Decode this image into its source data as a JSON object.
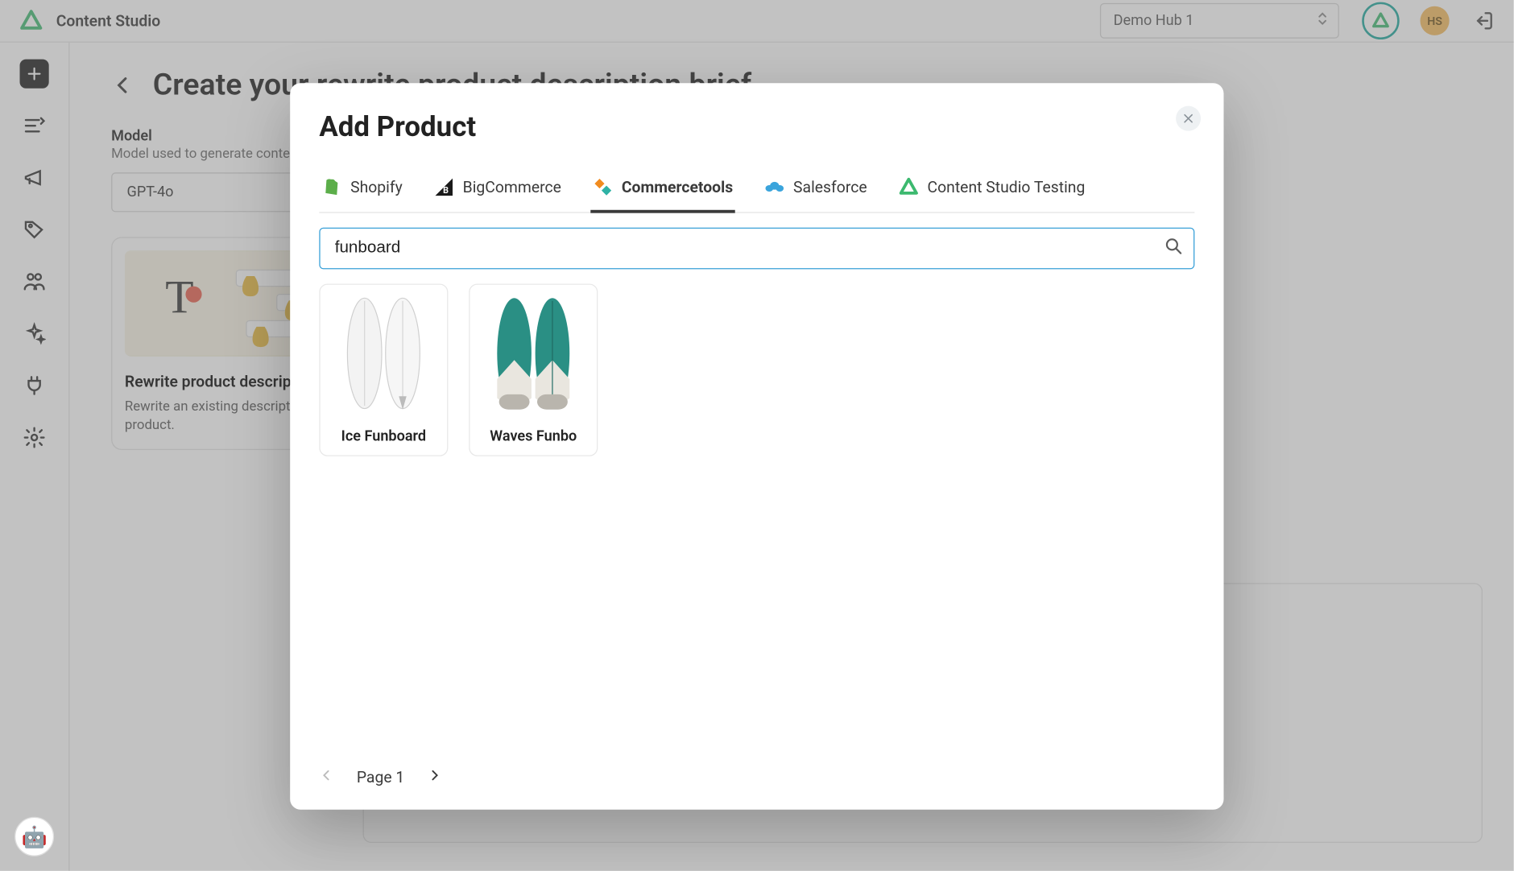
{
  "app": {
    "title": "Content Studio"
  },
  "topbar": {
    "hub_value": "Demo Hub 1",
    "avatar_initials": "HS"
  },
  "sidebar": {
    "items": [
      {
        "name": "create",
        "icon": "plus"
      },
      {
        "name": "content",
        "icon": "lines"
      },
      {
        "name": "campaigns",
        "icon": "megaphone"
      },
      {
        "name": "tags",
        "icon": "tag"
      },
      {
        "name": "people",
        "icon": "people"
      },
      {
        "name": "sparkle",
        "icon": "sparkle"
      },
      {
        "name": "plug",
        "icon": "plug"
      },
      {
        "name": "settings",
        "icon": "gear"
      }
    ]
  },
  "page": {
    "title": "Create your rewrite product description brief",
    "model_label": "Model",
    "model_hint": "Model used to generate content",
    "model_value": "GPT-4o",
    "card": {
      "title": "Rewrite product description",
      "desc": "Rewrite an existing description for your product."
    }
  },
  "modal": {
    "title": "Add Product",
    "tabs": [
      {
        "label": "Shopify",
        "active": false,
        "icon": "shopify"
      },
      {
        "label": "BigCommerce",
        "active": false,
        "icon": "bigcommerce"
      },
      {
        "label": "Commercetools",
        "active": true,
        "icon": "commercetools"
      },
      {
        "label": "Salesforce",
        "active": false,
        "icon": "salesforce"
      },
      {
        "label": "Content Studio Testing",
        "active": false,
        "icon": "cstudio"
      }
    ],
    "search_value": "funboard",
    "search_placeholder": "",
    "results": [
      {
        "name": "Ice Funboard",
        "variant": "ice"
      },
      {
        "name": "Waves Funbo",
        "variant": "waves"
      }
    ],
    "pager": {
      "label": "Page 1"
    }
  },
  "chat_fab": {
    "emoji": "🤖"
  },
  "colors": {
    "accent_teal": "#19a69c",
    "focus_blue": "#39a0d8",
    "shopify": "#5cae4a",
    "commercetools1": "#f18c1f",
    "commercetools2": "#2fb2a5",
    "salesforce": "#3aa4dc",
    "avatar_bg": "#f5bb5c"
  }
}
